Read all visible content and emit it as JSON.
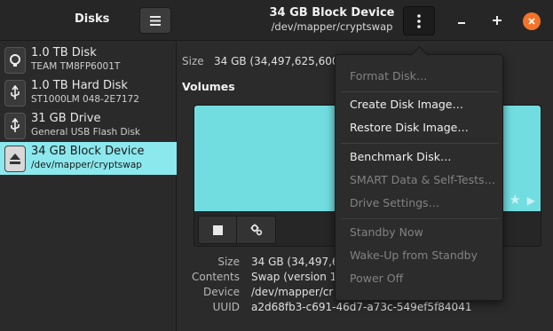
{
  "header": {
    "sidebar_title": "Disks",
    "device_title": "34 GB Block Device",
    "device_path": "/dev/mapper/cryptswap"
  },
  "sidebar": {
    "disks": [
      {
        "name": "1.0 TB Disk",
        "sub": "TEAM TM8FP6001T",
        "icon": "ssd-drive-icon",
        "selected": false
      },
      {
        "name": "1.0 TB Hard Disk",
        "sub": "ST1000LM 048-2E7172",
        "icon": "usb-drive-icon",
        "selected": false
      },
      {
        "name": "31 GB Drive",
        "sub": "General USB Flash Disk",
        "icon": "usb-drive-icon",
        "selected": false
      },
      {
        "name": "34 GB Block Device",
        "sub": "/dev/mapper/cryptswap",
        "icon": "eject-icon",
        "selected": true
      }
    ]
  },
  "main": {
    "size_label": "Size",
    "size_value": "34 GB (34,497,625,600 b",
    "volumes_heading": "Volumes",
    "info": {
      "size_label": "Size",
      "size_value": "34 GB (34,497,62",
      "contents_label": "Contents",
      "contents_value": "Swap (version 1",
      "device_label": "Device",
      "device_value": "/dev/mapper/cr",
      "uuid_label": "UUID",
      "uuid_value": "a2d68fb3-c691-46d7-a73c-549ef5f84041"
    }
  },
  "menu": {
    "items": [
      {
        "label": "Format Disk…",
        "enabled": false
      },
      {
        "label": "Create Disk Image…",
        "enabled": true
      },
      {
        "label": "Restore Disk Image…",
        "enabled": true
      },
      {
        "label": "Benchmark Disk…",
        "enabled": true
      },
      {
        "label": "SMART Data & Self-Tests…",
        "enabled": false
      },
      {
        "label": "Drive Settings…",
        "enabled": false
      },
      {
        "label": "Standby Now",
        "enabled": false
      },
      {
        "label": "Wake-Up from Standby",
        "enabled": false
      },
      {
        "label": "Power Off",
        "enabled": false
      }
    ]
  },
  "colors": {
    "selected_bg": "#8be8ec",
    "volume_fill": "#72dde1",
    "close_button": "#f37329"
  }
}
